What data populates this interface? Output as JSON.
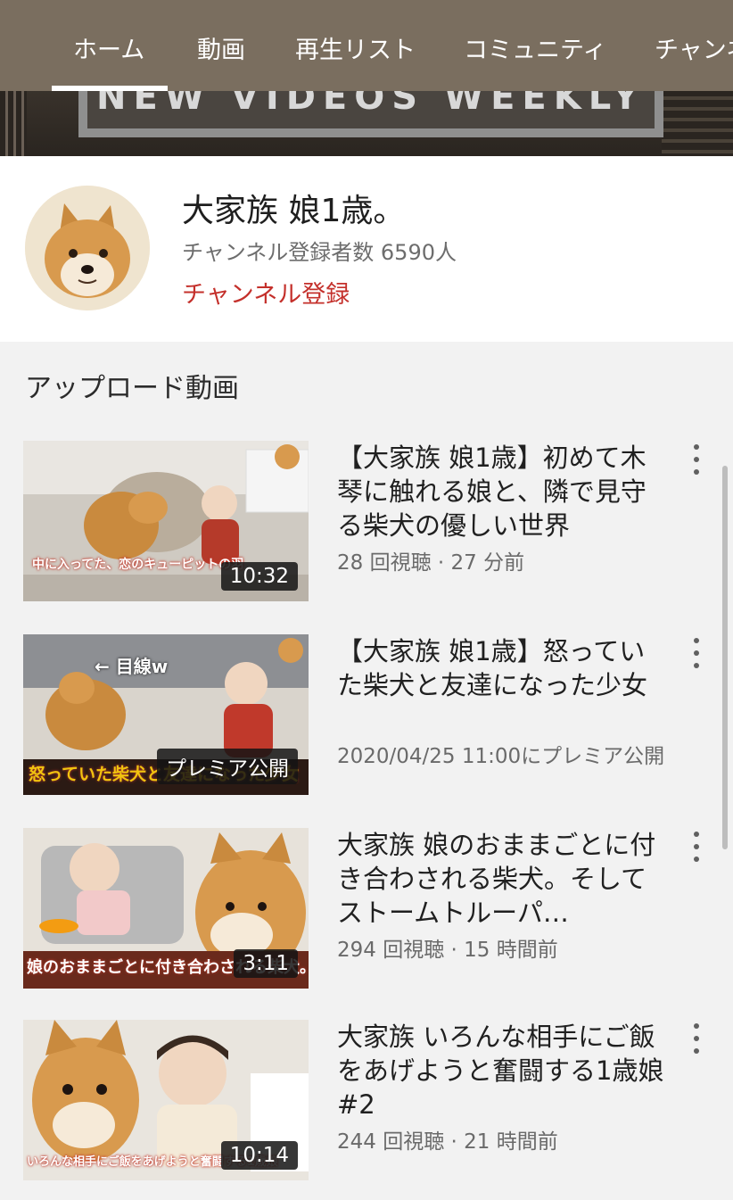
{
  "tabs": [
    {
      "label": "ホーム",
      "active": true
    },
    {
      "label": "動画"
    },
    {
      "label": "再生リスト"
    },
    {
      "label": "コミュニティ"
    },
    {
      "label": "チャンネ"
    }
  ],
  "banner": {
    "text": "NEW VIDEOS WEEKLY"
  },
  "channel": {
    "name": "大家族 娘1歳。",
    "subscribers": "チャンネル登録者数 6590人",
    "subscribe_label": "チャンネル登録"
  },
  "section": {
    "title": "アップロード動画"
  },
  "videos": [
    {
      "title": "【大家族 娘1歳】初めて木琴に触れる娘と、隣で見守る柴犬の優しい世界",
      "meta": "28 回視聴 · 27 分前",
      "duration": "10:32",
      "caption": "中に入ってた、恋のキューピットの羽"
    },
    {
      "title": "【大家族 娘1歳】怒っていた柴犬と友達になった少女",
      "meta": "2020/04/25 11:00にプレミア公開",
      "duration": "プレミア公開",
      "caption": "怒っていた柴犬と友達になった少女",
      "overlay": "← 目線w"
    },
    {
      "title": "大家族 娘のおままごとに付き合わされる柴犬。そしてストームトルーパ…",
      "meta": "294 回視聴 · 15 時間前",
      "duration": "3:11",
      "caption": "娘のおままごとに付き合わされる柴犬。"
    },
    {
      "title": "大家族 いろんな相手にご飯をあげようと奮闘する1歳娘 #2",
      "meta": "244 回視聴 · 21 時間前",
      "duration": "10:14",
      "caption": "いろんな相手にご飯をあげようと奮闘する1歳娘"
    }
  ],
  "colors": {
    "tab_bar": "#7a6e5f",
    "subscribe": "#c4302b",
    "background": "#f2f2f2"
  }
}
